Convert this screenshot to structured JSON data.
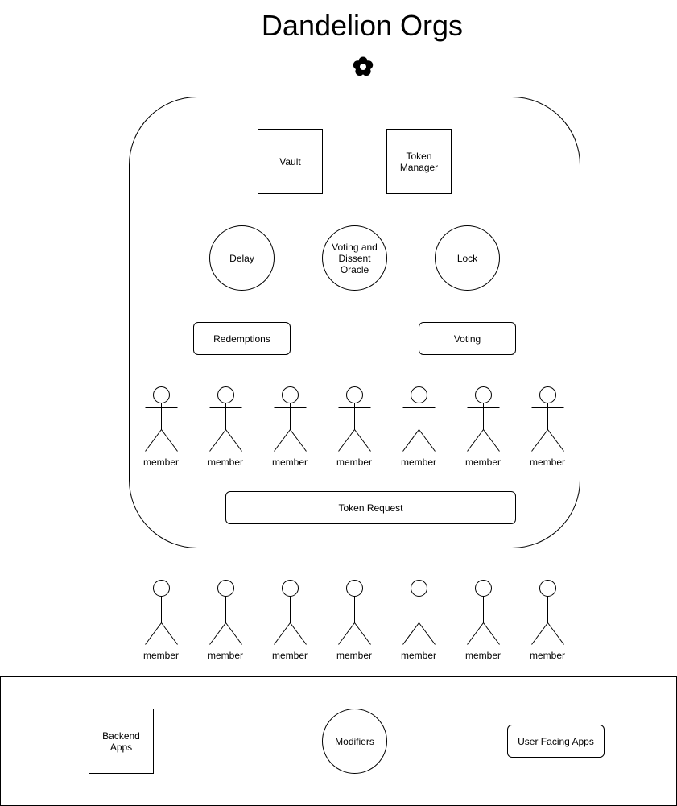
{
  "title": "Dandelion Orgs",
  "logo_icon": "flower-icon",
  "org": {
    "vault": "Vault",
    "token_manager": "Token\nManager",
    "delay": "Delay",
    "voting_oracle": "Voting and\nDissent\nOracle",
    "lock": "Lock",
    "redemptions": "Redemptions",
    "voting": "Voting",
    "members": [
      "member",
      "member",
      "member",
      "member",
      "member",
      "member",
      "member"
    ],
    "token_request": "Token Request"
  },
  "outside_members": [
    "member",
    "member",
    "member",
    "member",
    "member",
    "member",
    "member"
  ],
  "apps": {
    "backend": "Backend\nApps",
    "modifiers": "Modifiers",
    "user_facing": "User Facing Apps"
  }
}
